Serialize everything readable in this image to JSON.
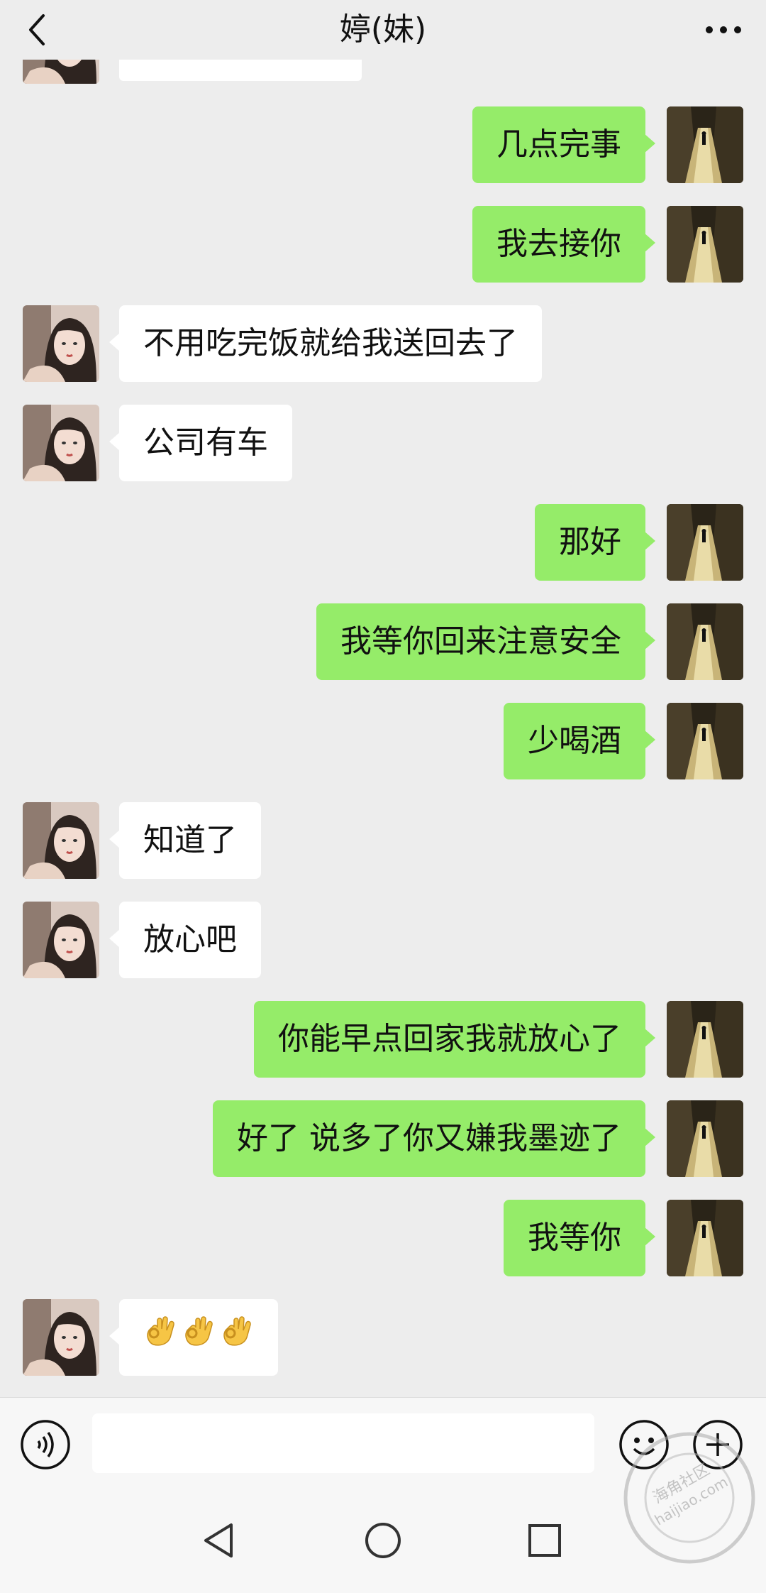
{
  "header": {
    "title": "婷(妹)"
  },
  "messages": [
    {
      "from": "me",
      "text": "几点完事"
    },
    {
      "from": "me",
      "text": "我去接你"
    },
    {
      "from": "her",
      "text": "不用吃完饭就给我送回去了"
    },
    {
      "from": "her",
      "text": "公司有车"
    },
    {
      "from": "me",
      "text": "那好"
    },
    {
      "from": "me",
      "text": "我等你回来注意安全"
    },
    {
      "from": "me",
      "text": "少喝酒"
    },
    {
      "from": "her",
      "text": "知道了"
    },
    {
      "from": "her",
      "text": "放心吧"
    },
    {
      "from": "me",
      "text": "你能早点回家我就放心了"
    },
    {
      "from": "me",
      "text": "好了 说多了你又嫌我墨迹了"
    },
    {
      "from": "me",
      "text": "我等你"
    },
    {
      "from": "her",
      "emoji": [
        "ok-hand-emoji",
        "ok-hand-emoji",
        "ok-hand-emoji"
      ]
    }
  ],
  "input": {
    "value": "",
    "placeholder": ""
  },
  "watermark": {
    "line1": "海角社区",
    "line2": "haijiao.com"
  },
  "colors": {
    "background": "#ededed",
    "my_bubble": "#95ec69",
    "her_bubble": "#ffffff",
    "text": "#111111"
  }
}
